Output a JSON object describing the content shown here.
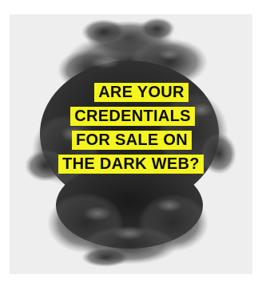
{
  "ad": {
    "headline_lines": [
      "ARE YOUR",
      "CREDENTIALS",
      "FOR SALE ON",
      "THE DARK WEB?"
    ],
    "highlight_color": "#f4f41e",
    "text_color": "#0d0d0d",
    "background_color": "#eeeeee",
    "artwork": "black-ink-smoke-cloud"
  }
}
